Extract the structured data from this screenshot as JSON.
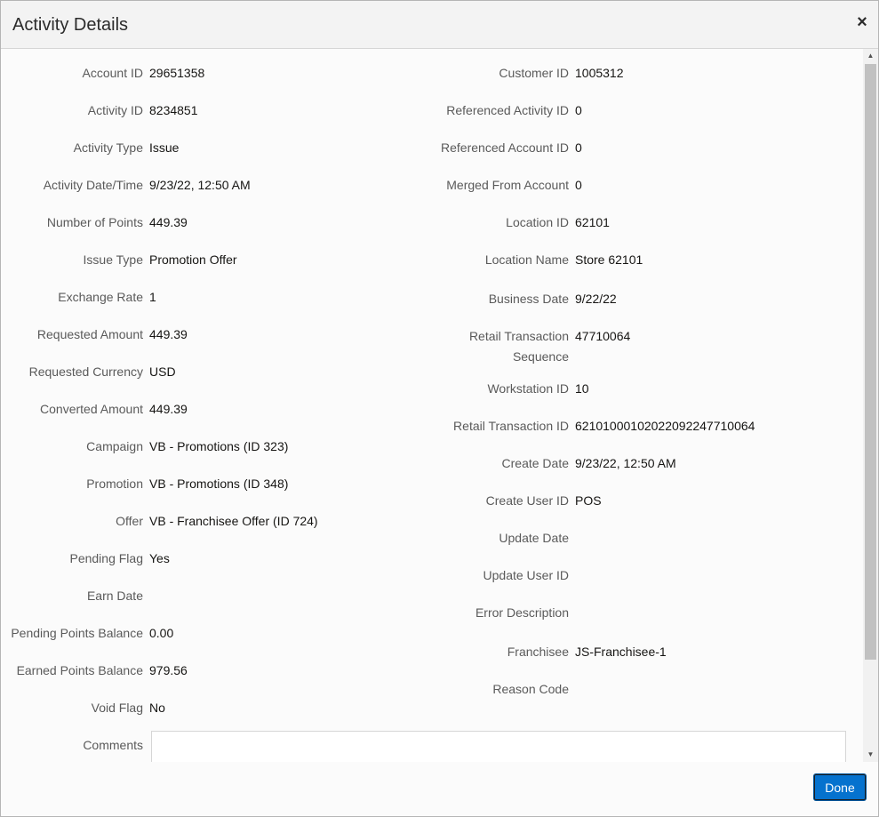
{
  "dialog": {
    "title": "Activity Details",
    "close_glyph": "×",
    "done_label": "Done"
  },
  "left_fields": [
    {
      "label": "Account ID",
      "value": "29651358"
    },
    {
      "label": "Activity ID",
      "value": "8234851"
    },
    {
      "label": "Activity Type",
      "value": "Issue"
    },
    {
      "label": "Activity Date/Time",
      "value": "9/23/22, 12:50 AM"
    },
    {
      "label": "Number of Points",
      "value": "449.39"
    },
    {
      "label": "Issue Type",
      "value": "Promotion Offer"
    },
    {
      "label": "Exchange Rate",
      "value": "1"
    },
    {
      "label": "Requested Amount",
      "value": "449.39"
    },
    {
      "label": "Requested Currency",
      "value": "USD"
    },
    {
      "label": "Converted Amount",
      "value": "449.39"
    },
    {
      "label": "Campaign",
      "value": "VB - Promotions (ID 323)"
    },
    {
      "label": "Promotion",
      "value": "VB - Promotions (ID 348)"
    },
    {
      "label": "Offer",
      "value": "VB - Franchisee Offer (ID 724)"
    },
    {
      "label": "Pending Flag",
      "value": "Yes"
    },
    {
      "label": "Earn Date",
      "value": ""
    },
    {
      "label": "Pending Points Balance",
      "value": "0.00"
    },
    {
      "label": "Earned Points Balance",
      "value": "979.56"
    },
    {
      "label": "Void Flag",
      "value": "No"
    },
    {
      "label": "Comments",
      "value": ""
    }
  ],
  "right_fields": [
    {
      "label": "Customer ID",
      "value": "1005312"
    },
    {
      "label": "Referenced Activity ID",
      "value": "0"
    },
    {
      "label": "Referenced Account ID",
      "value": "0"
    },
    {
      "label": "Merged From Account",
      "value": "0"
    },
    {
      "label": "Location ID",
      "value": "62101"
    },
    {
      "label": "Location Name",
      "value": "Store 62101"
    },
    {
      "label": "Business Date",
      "value": "9/22/22"
    },
    {
      "label": "Retail Transaction",
      "label_line2": "Sequence",
      "value": "47710064"
    },
    {
      "label": "Workstation ID",
      "value": "10"
    },
    {
      "label": "Retail Transaction ID",
      "value": "62101000102022092247710064"
    },
    {
      "label": "Create Date",
      "value": "9/23/22, 12:50 AM"
    },
    {
      "label": "Create User ID",
      "value": "POS"
    },
    {
      "label": "Update Date",
      "value": ""
    },
    {
      "label": "Update User ID",
      "value": ""
    },
    {
      "label": "Error Description",
      "value": ""
    },
    {
      "label": "Franchisee",
      "value": "JS-Franchisee-1"
    },
    {
      "label": "Reason Code",
      "value": ""
    }
  ],
  "scrollbar": {
    "up_glyph": "▲",
    "down_glyph": "▼"
  }
}
